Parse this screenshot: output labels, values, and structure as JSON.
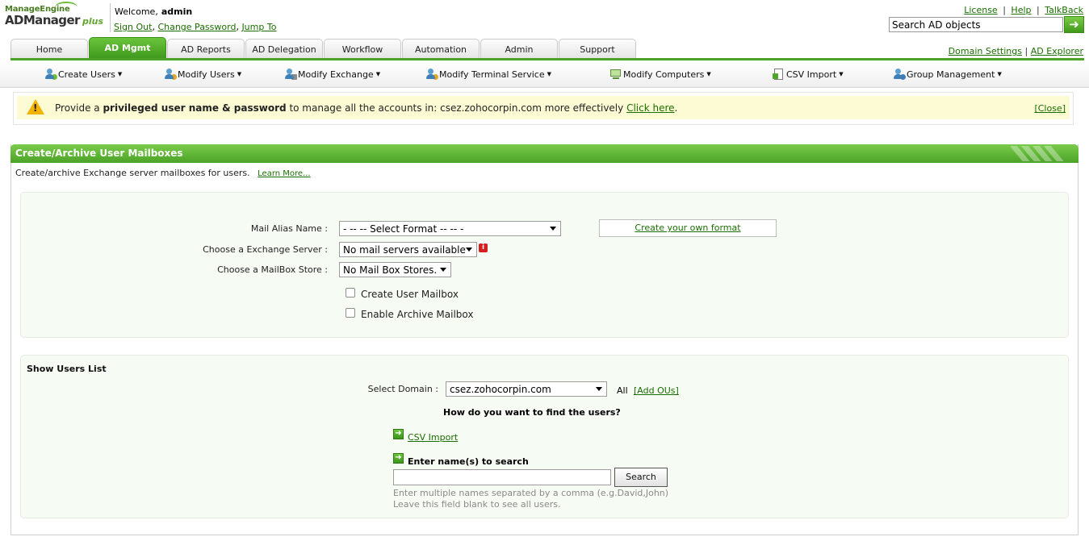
{
  "logo": {
    "top": "ManageEngine",
    "main": "ADManager",
    "plus": "plus"
  },
  "welcome": {
    "label": "Welcome,",
    "user": "admin",
    "sign_out": "Sign Out",
    "sep1": ",",
    "change_password": "Change Password",
    "sep2": ",",
    "jump_to": "Jump To"
  },
  "toplinks": {
    "license": "License",
    "help": "Help",
    "talkback": "TalkBack",
    "sep": "|"
  },
  "search": {
    "placeholder": "Search AD objects",
    "go_icon": "arrow-right-icon"
  },
  "tabs": [
    "Home",
    "AD Mgmt",
    "AD Reports",
    "AD Delegation",
    "Workflow",
    "Automation",
    "Admin",
    "Support"
  ],
  "active_tab": "AD Mgmt",
  "rightlinks": {
    "domain_settings": "Domain Settings",
    "ad_explorer": "AD Explorer",
    "sep": "|"
  },
  "subnav": [
    "Create Users",
    "Modify Users",
    "Modify Exchange",
    "Modify Terminal Service",
    "Modify Computers",
    "CSV Import",
    "Group Management"
  ],
  "warning": {
    "pre": "Provide a",
    "bold": "privileged user name & password",
    "mid": "to manage all the accounts in: csez.zohocorpin.com more effectively",
    "link": "Click here",
    "end": ".",
    "close": "[Close]"
  },
  "panel": {
    "title": "Create/Archive User Mailboxes",
    "desc": "Create/archive Exchange server mailboxes for users.",
    "learn_more": "Learn More..."
  },
  "form": {
    "mail_alias_label": "Mail Alias Name :",
    "mail_alias_value": "- -- -- Select Format -- -- -",
    "create_format": "Create your own format",
    "exchange_label": "Choose a Exchange Server :",
    "exchange_value": "No mail servers available",
    "info_icon": "i",
    "mailbox_label": "Choose a MailBox Store :",
    "mailbox_value": "No Mail Box Stores.",
    "create_mailbox": "Create User Mailbox",
    "archive_mailbox": "Enable Archive Mailbox"
  },
  "users": {
    "title": "Show Users List",
    "domain_label": "Select Domain :",
    "domain_value": "csez.zohocorpin.com",
    "all": "All",
    "add_ous": "[Add OUs]",
    "question": "How do you want to find the users?",
    "csv_import": "CSV Import",
    "enter_names": "Enter name(s) to search",
    "search_btn": "Search",
    "hint1": "Enter multiple names separated by a comma (e.g.David,John)",
    "hint2": "Leave this field blank to see all users."
  },
  "colors": {
    "accent": "#4ba226",
    "link": "#1a6e00",
    "warning_bg": "#fdfbd4",
    "panel_bg": "#f6fbf3"
  }
}
